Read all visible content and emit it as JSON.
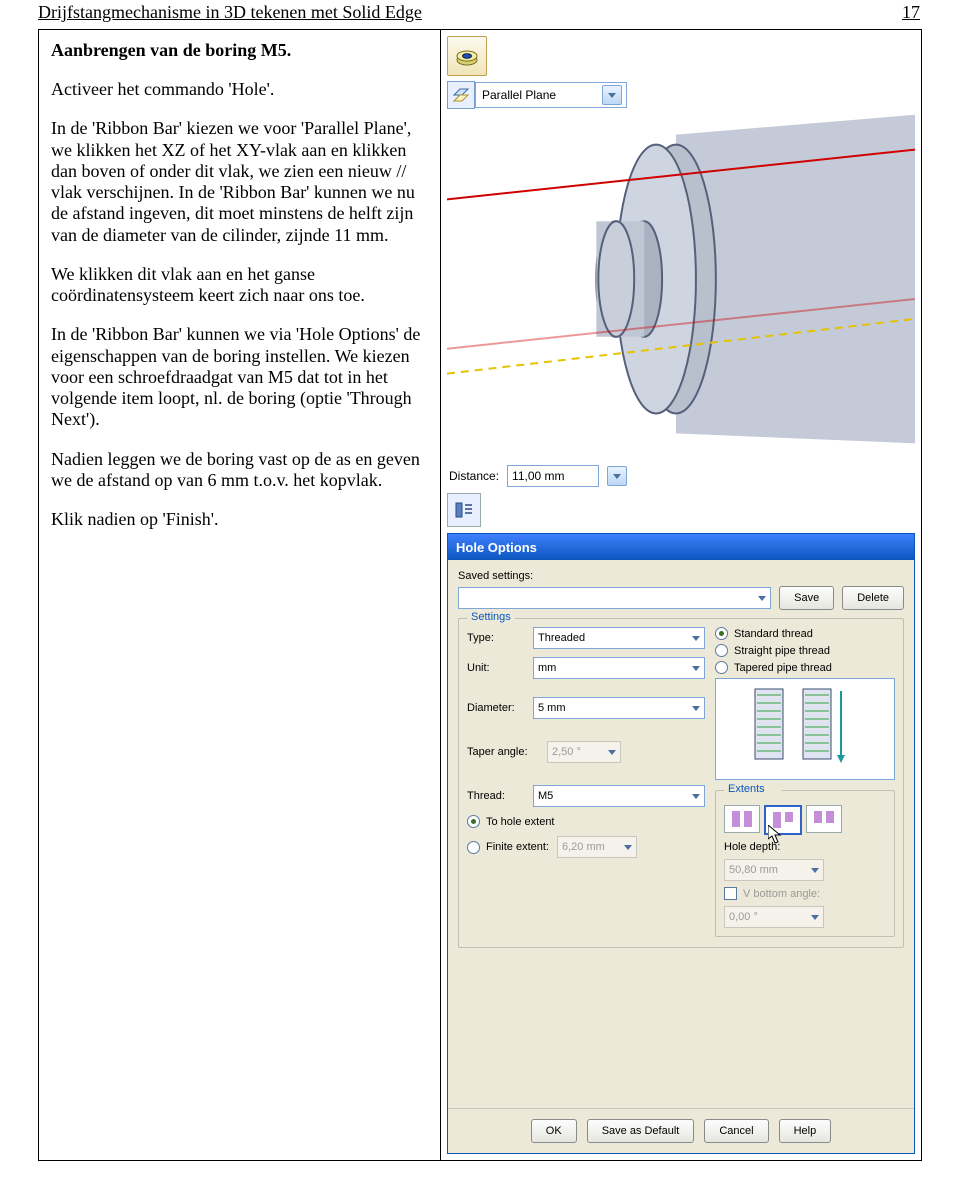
{
  "header": {
    "title": "Drijfstangmechanisme in 3D tekenen met Solid Edge",
    "page": "17"
  },
  "instructions": {
    "h1": "Aanbrengen van de boring M5.",
    "p1": "Activeer het commando 'Hole'.",
    "p2": "In de 'Ribbon Bar' kiezen we voor 'Parallel Plane', we klikken het XZ of het XY-vlak aan en klikken dan boven of onder dit vlak, we zien een nieuw // vlak verschijnen. In de 'Ribbon Bar' kunnen we nu de afstand ingeven, dit moet minstens de helft zijn van de diameter van de cilinder, zijnde 11 mm.",
    "p3": "We klikken dit vlak aan en het ganse coördinatensysteem keert zich naar ons toe.",
    "p4": "In de 'Ribbon Bar' kunnen we via 'Hole Options' de eigenschappen van de boring instellen. We kiezen voor een schroefdraadgat van M5 dat tot in het volgende item loopt, nl. de boring (optie 'Through Next').",
    "p5": "Nadien leggen we de boring vast op de as en geven we de afstand op van 6 mm t.o.v. het kopvlak.",
    "p6": "Klik nadien op 'Finish'."
  },
  "ribbon": {
    "parallel_plane": "Parallel Plane",
    "distance_label": "Distance:",
    "distance_value": "11,00 mm"
  },
  "dialog": {
    "title": "Hole Options",
    "saved_settings_label": "Saved settings:",
    "save": "Save",
    "delete": "Delete",
    "settings_legend": "Settings",
    "type_label": "Type:",
    "type_value": "Threaded",
    "unit_label": "Unit:",
    "unit_value": "mm",
    "diameter_label": "Diameter:",
    "diameter_value": "5 mm",
    "taper_label": "Taper angle:",
    "taper_value": "2,50 °",
    "thread_label": "Thread:",
    "thread_value": "M5",
    "to_hole_extent": "To hole extent",
    "finite_extent": "Finite extent:",
    "finite_value": "6,20 mm",
    "standard_thread": "Standard thread",
    "straight_pipe": "Straight pipe thread",
    "tapered_pipe": "Tapered pipe thread",
    "extents_legend": "Extents",
    "hole_depth_label": "Hole depth:",
    "hole_depth_value": "50,80 mm",
    "vbottom_label": "V bottom angle:",
    "vbottom_value": "0,00 °",
    "ok": "OK",
    "save_default": "Save as Default",
    "cancel": "Cancel",
    "help": "Help"
  }
}
